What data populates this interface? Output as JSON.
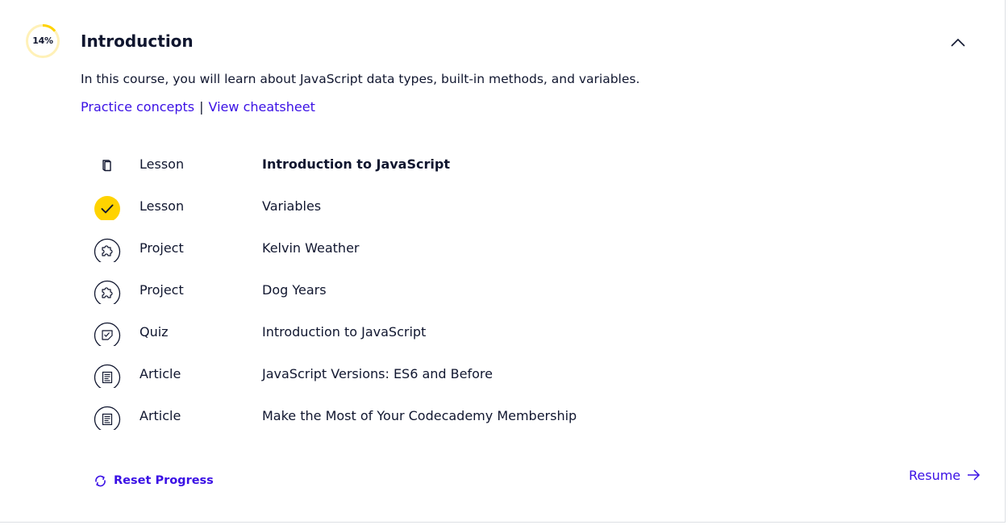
{
  "module": {
    "progress_label": "14%",
    "progress_fraction": 0.14,
    "title": "Introduction",
    "description": "In this course, you will learn about JavaScript data types, built-in methods, and variables.",
    "links": {
      "practice": "Practice concepts",
      "separator": "|",
      "cheatsheet": "View cheatsheet"
    }
  },
  "items": [
    {
      "type": "Lesson",
      "name": "Introduction to JavaScript",
      "icon": "book-icon",
      "state": "current"
    },
    {
      "type": "Lesson",
      "name": "Variables",
      "icon": "check-icon",
      "state": "completed"
    },
    {
      "type": "Project",
      "name": "Kelvin Weather",
      "icon": "puzzle-icon",
      "state": "incomplete"
    },
    {
      "type": "Project",
      "name": "Dog Years",
      "icon": "puzzle-icon",
      "state": "incomplete"
    },
    {
      "type": "Quiz",
      "name": "Introduction to JavaScript",
      "icon": "quiz-icon",
      "state": "incomplete"
    },
    {
      "type": "Article",
      "name": "JavaScript Versions: ES6 and Before",
      "icon": "article-icon",
      "state": "incomplete"
    },
    {
      "type": "Article",
      "name": "Make the Most of Your Codecademy Membership",
      "icon": "article-icon",
      "state": "incomplete"
    }
  ],
  "actions": {
    "reset": "Reset Progress",
    "resume": "Resume"
  },
  "colors": {
    "accent": "#3a10e5",
    "progress": "#ffd300",
    "progress_track": "#fff0b3",
    "text": "#10162f"
  }
}
